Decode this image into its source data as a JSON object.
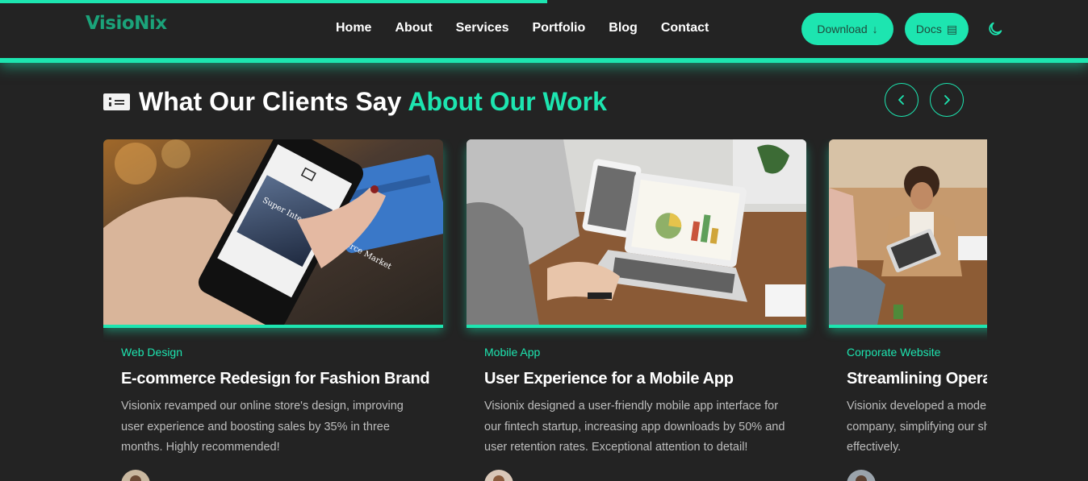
{
  "brand": {
    "name": "VisioNix"
  },
  "nav": [
    {
      "label": "Home"
    },
    {
      "label": "About"
    },
    {
      "label": "Services"
    },
    {
      "label": "Portfolio"
    },
    {
      "label": "Blog"
    },
    {
      "label": "Contact"
    }
  ],
  "actions": {
    "download_label": "Download",
    "download_icon": "↓",
    "docs_label": "Docs",
    "docs_icon": "▤",
    "theme_icon": "moon-icon"
  },
  "section": {
    "title_main": "What Our Clients Say",
    "title_accent": "About Our Work",
    "prev_icon": "‹",
    "next_icon": "›"
  },
  "cards": [
    {
      "category": "Web Design",
      "title": "E-commerce Redesign for Fashion Brand",
      "text": "Visionix revamped our online store's design, improving user experience and boosting sales by 35% in three months. Highly recommended!",
      "image": "phone-shopping-photo",
      "screen_text": "Super Internet eCommerce Market"
    },
    {
      "category": "Mobile App",
      "title": "User Experience for a Mobile App",
      "text": "Visionix designed a user-friendly mobile app interface for our fintech startup, increasing app downloads by 50% and user retention rates. Exceptional attention to detail!",
      "image": "laptop-meeting-photo"
    },
    {
      "category": "Corporate Website",
      "title": "Streamlining Operations",
      "text": "Visionix developed a modern website for our tech company, simplifying our showcasing our services effectively.",
      "image": "office-woman-photo"
    }
  ],
  "colors": {
    "accent": "#1de5b0",
    "bg": "#232323"
  }
}
